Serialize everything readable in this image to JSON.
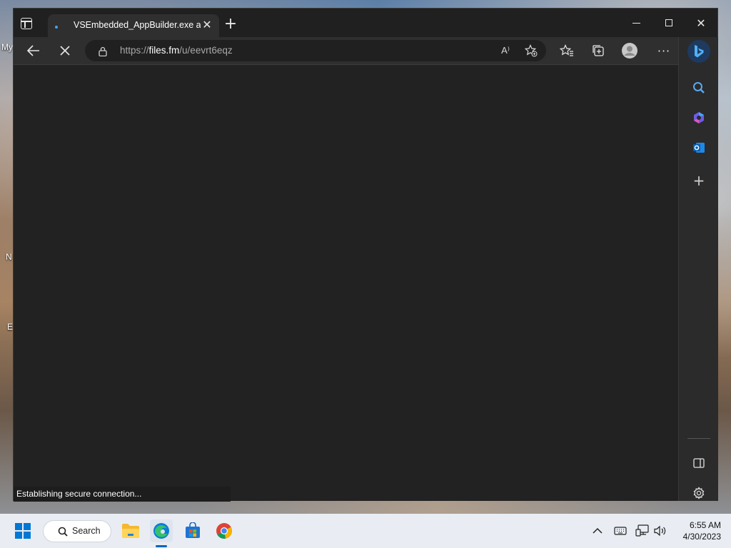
{
  "desktop": {
    "edge_labels": [
      "My",
      "N",
      "E"
    ]
  },
  "browser": {
    "tab": {
      "title": "VSEmbedded_AppBuilder.exe and"
    },
    "address": {
      "scheme": "https://",
      "host": "files.fm",
      "path": "/u/eevrt6eqz"
    },
    "status_text": "Establishing secure connection...",
    "read_aloud_label": "A⁾"
  },
  "taskbar": {
    "search_label": "Search",
    "time": "6:55 AM",
    "date": "4/30/2023"
  },
  "colors": {
    "edge_blue": "#0078d4",
    "window_bg": "#202020",
    "toolbar_bg": "#2f2f2f"
  }
}
